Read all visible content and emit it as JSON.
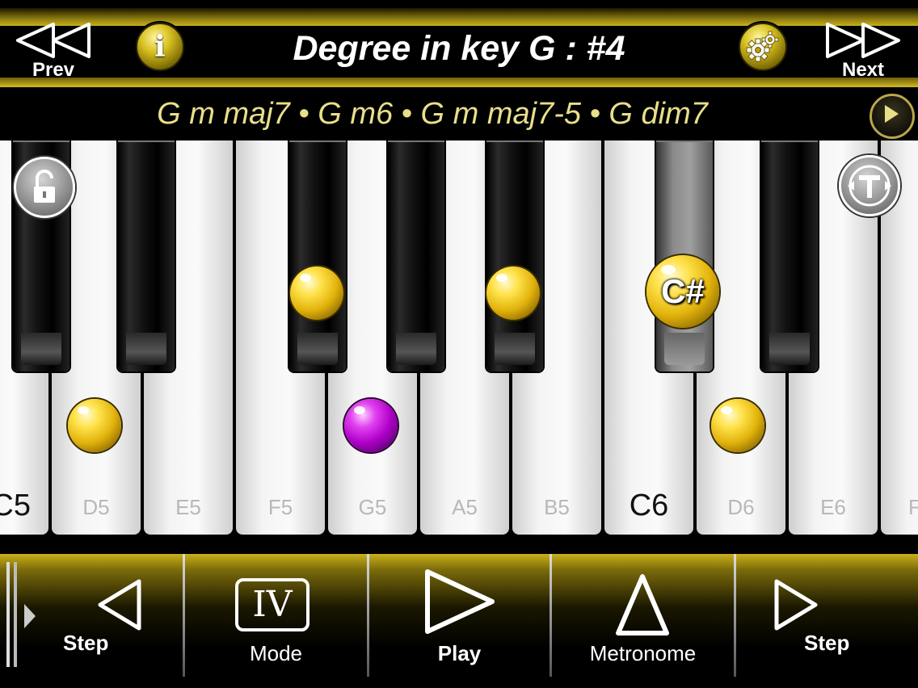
{
  "header": {
    "prev_label": "Prev",
    "next_label": "Next",
    "title": "Degree in key G : #4"
  },
  "chord_bar": {
    "chords": "G m maj7 • G m6 • G m maj7-5 • G dim7"
  },
  "keyboard": {
    "white_keys": [
      "C5",
      "D5",
      "E5",
      "F5",
      "G5",
      "A5",
      "B5",
      "C6",
      "D6",
      "E6",
      "F"
    ],
    "highlighted_key_label": "C#"
  },
  "toolbar": {
    "step_back_label": "Step",
    "mode_label": "Mode",
    "mode_value": "IV",
    "play_label": "Play",
    "metronome_label": "Metronome",
    "step_forward_label": "Step"
  },
  "colors": {
    "accent_gold": "#d4bc22",
    "chord_text": "#e8df8a",
    "note_gold": "#e2b30c",
    "note_purple": "#b000c8"
  }
}
